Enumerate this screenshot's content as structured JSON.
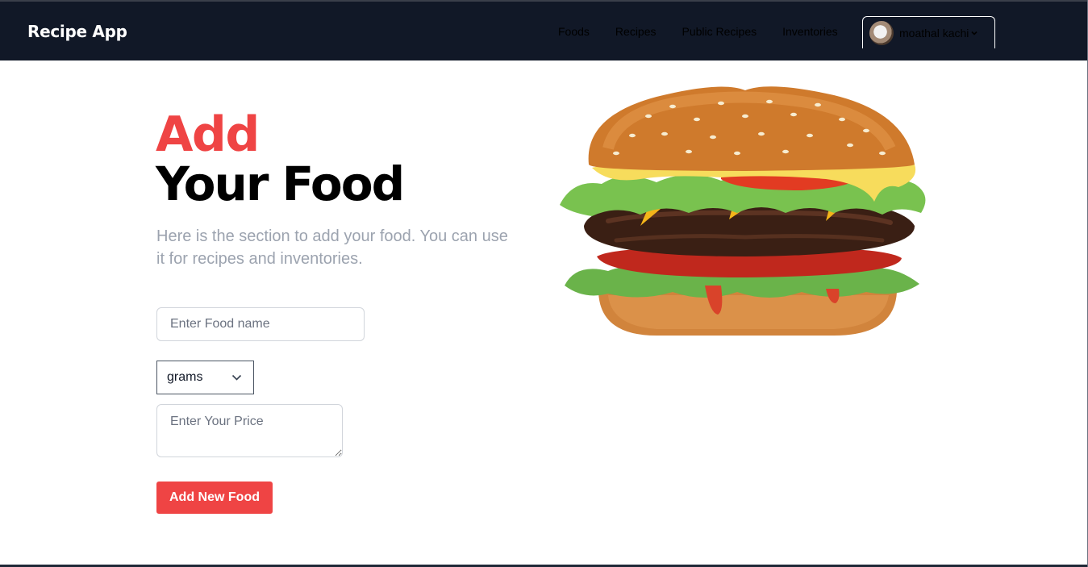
{
  "header": {
    "brand": "Recipe App",
    "nav": [
      "Foods",
      "Recipes",
      "Public Recipes",
      "Inventories"
    ],
    "user_name": "moathal kachi"
  },
  "main": {
    "title_accent": "Add",
    "title_main": "Your Food",
    "subtitle": "Here is the section to add your food. You can use it for recipes and inventories.",
    "food_name_placeholder": "Enter Food name",
    "unit_selected": "grams",
    "price_placeholder": "Enter Your Price",
    "add_button_label": "Add New Food"
  },
  "colors": {
    "header_bg": "#111827",
    "accent": "#ef4444",
    "subtitle_text": "#9ca3af"
  },
  "icons": {
    "user_menu_chevron": "chevron-down-icon",
    "select_chevron": "chevron-down-icon",
    "hero_image": "burger-image"
  }
}
